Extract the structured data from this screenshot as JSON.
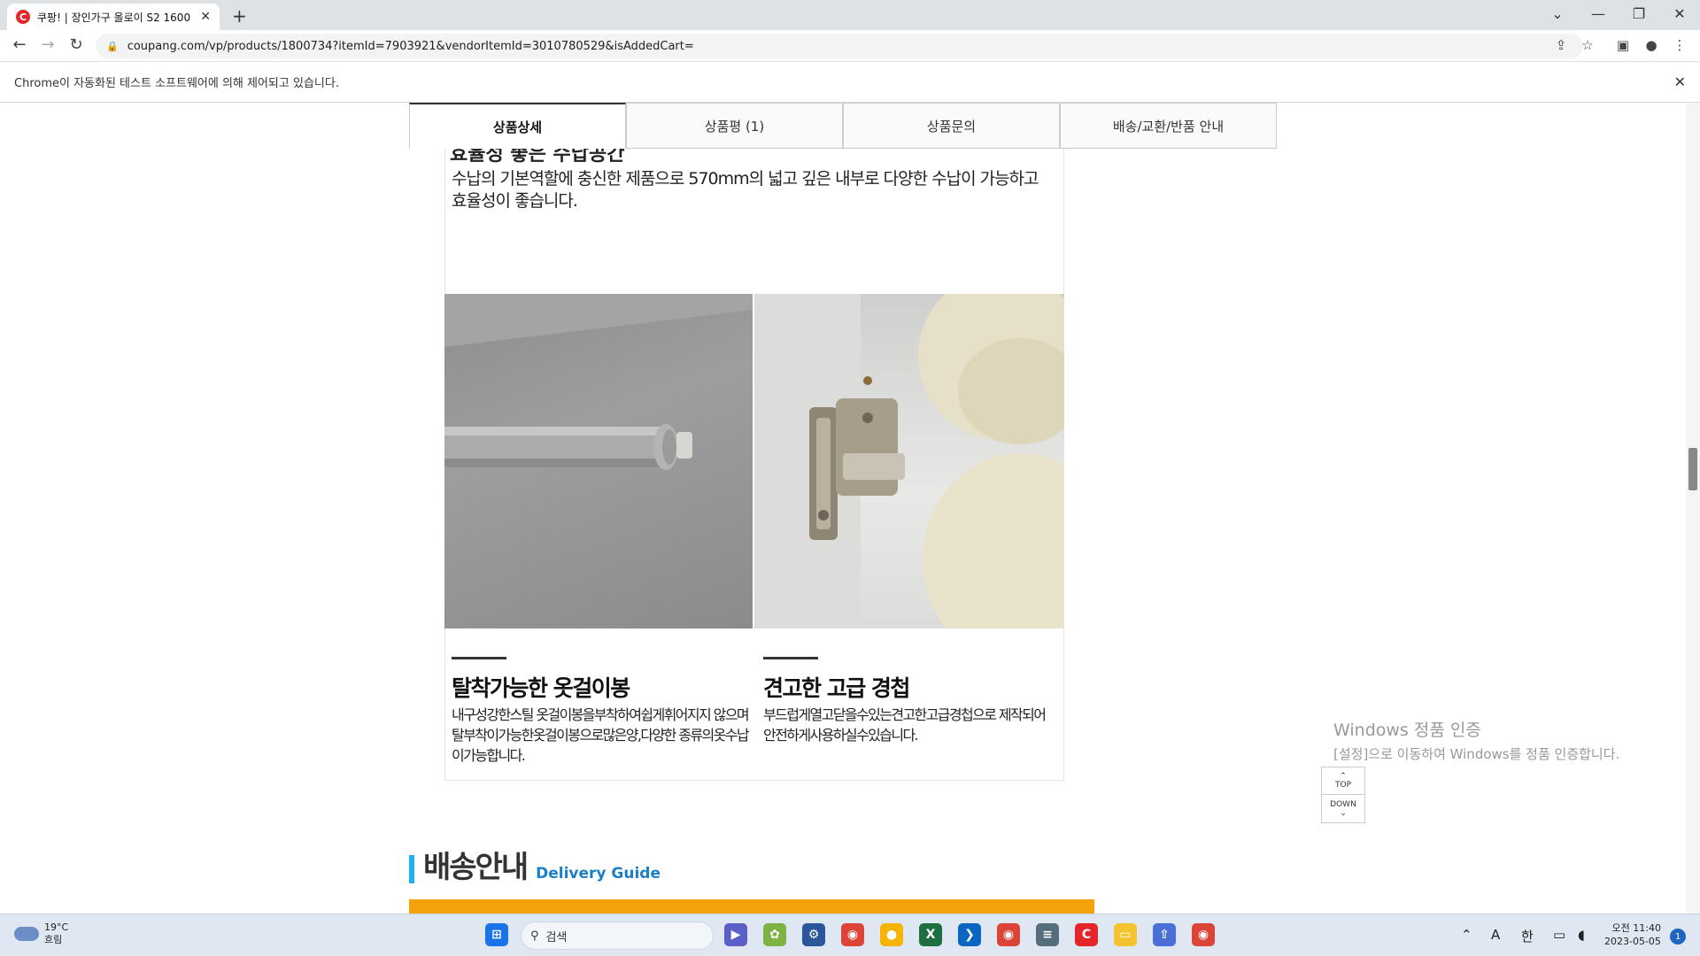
{
  "browser": {
    "tab_title": "쿠팡! | 장인가구 올로이 S2 1600",
    "favicon_letter": "C",
    "url": "coupang.com/vp/products/1800734?itemId=7903921&vendorItemId=3010780529&isAddedCart=",
    "infobar_text": "Chrome이 자동화된 테스트 소프트웨어에 의해 제어되고 있습니다."
  },
  "product_tabs": [
    "상품상세",
    "상품평 (1)",
    "상품문의",
    "배송/교환/반품 안내"
  ],
  "detail": {
    "cut_heading": "효율성 좋은 수납공간",
    "intro": "수납의 기본역할에 충신한 제품으로 570mm의 넓고 깊은 내부로 다양한 수납이 가능하고 효율성이 좋습니다.",
    "features": [
      {
        "title": "탈착가능한 옷걸이봉",
        "desc": "내구성강한스틸 옷걸이봉을부착하여쉽게휘어지지 않으며탈부착이가능한옷걸이봉으로많은양,다양한 종류의옷수납이가능합니다."
      },
      {
        "title": "견고한 고급 경첩",
        "desc": "부드럽게열고닫을수있는견고한고급경첩으로 제작되어안전하게사용하실수있습니다."
      }
    ]
  },
  "topdown": {
    "top": "TOP",
    "down": "DOWN"
  },
  "shipping": {
    "title_ko": "배송안내",
    "title_en": "Delivery Guide"
  },
  "watermark": {
    "line1": "Windows 정품 인증",
    "line2": "[설정]으로 이동하여 Windows를 정품 인증합니다."
  },
  "taskbar": {
    "weather_temp": "19°C",
    "weather_desc": "흐림",
    "search_placeholder": "검색",
    "ime_a": "A",
    "ime_han": "한",
    "time": "오전 11:40",
    "date": "2023-05-05",
    "notification_count": "1"
  }
}
